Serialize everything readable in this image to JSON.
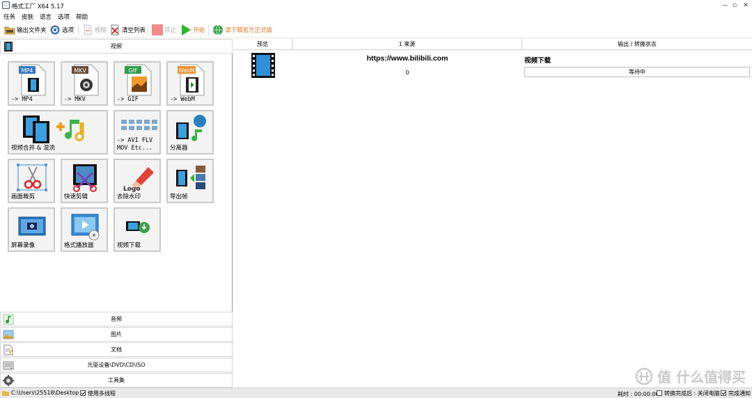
{
  "window": {
    "title": "格式工厂 X64 5.17",
    "controls": [
      "—",
      "▫",
      "✕"
    ]
  },
  "menu": [
    "任务",
    "皮肤",
    "语言",
    "选项",
    "帮助"
  ],
  "toolbar": {
    "output_folder": "输出文件夹",
    "options": "选项",
    "remove": "移除",
    "clear_list": "清空列表",
    "stop": "停止",
    "start": "开始",
    "download_official": "请下载官方正式版"
  },
  "left": {
    "video_header": "视频",
    "tiles": [
      {
        "label": "-> MP4",
        "badge": "MP4"
      },
      {
        "label": "-> MKV",
        "badge": "MKV"
      },
      {
        "label": "-> GIF",
        "badge": "GIF"
      },
      {
        "label": "-> WebM",
        "badge": "WebM"
      },
      {
        "label": "视频合并 & 混流"
      },
      {
        "label": "-> AVI FLV\nMOV Etc..."
      },
      {
        "label": "分离器"
      },
      {
        "label": "画面裁剪"
      },
      {
        "label": "快速剪辑"
      },
      {
        "label": "去除水印",
        "logo_text": "Logo"
      },
      {
        "label": "导出帧"
      },
      {
        "label": "屏幕录像"
      },
      {
        "label": "格式播放器"
      },
      {
        "label": "视频下载"
      }
    ],
    "categories": [
      {
        "label": "音频",
        "icon": "music-note-icon"
      },
      {
        "label": "图片",
        "icon": "picture-icon"
      },
      {
        "label": "文档",
        "icon": "document-icon"
      },
      {
        "label": "光驱设备\\DVD\\CD\\ISO",
        "icon": "disc-drive-icon"
      },
      {
        "label": "工具集",
        "icon": "tools-icon"
      }
    ]
  },
  "tasklist": {
    "columns": [
      "预览",
      "1 来源",
      "输出 / 转换状态"
    ],
    "rows": [
      {
        "source": "https://www.bilibili.com",
        "sub": "0",
        "output": "视频下载",
        "status": "等待中"
      }
    ]
  },
  "status": {
    "path": "C:\\Users\\25518\\Desktop",
    "multithread": "使用多线程",
    "elapsed": "耗时 : 00:00:00",
    "after_done": "转换完成后 : 关闭电脑",
    "notify": "完成通知"
  },
  "watermark": "值 什么值得买",
  "colors": {
    "accent_orange": "#e8711a",
    "start_green": "#2db52d",
    "stop_red": "#f08a8a"
  }
}
